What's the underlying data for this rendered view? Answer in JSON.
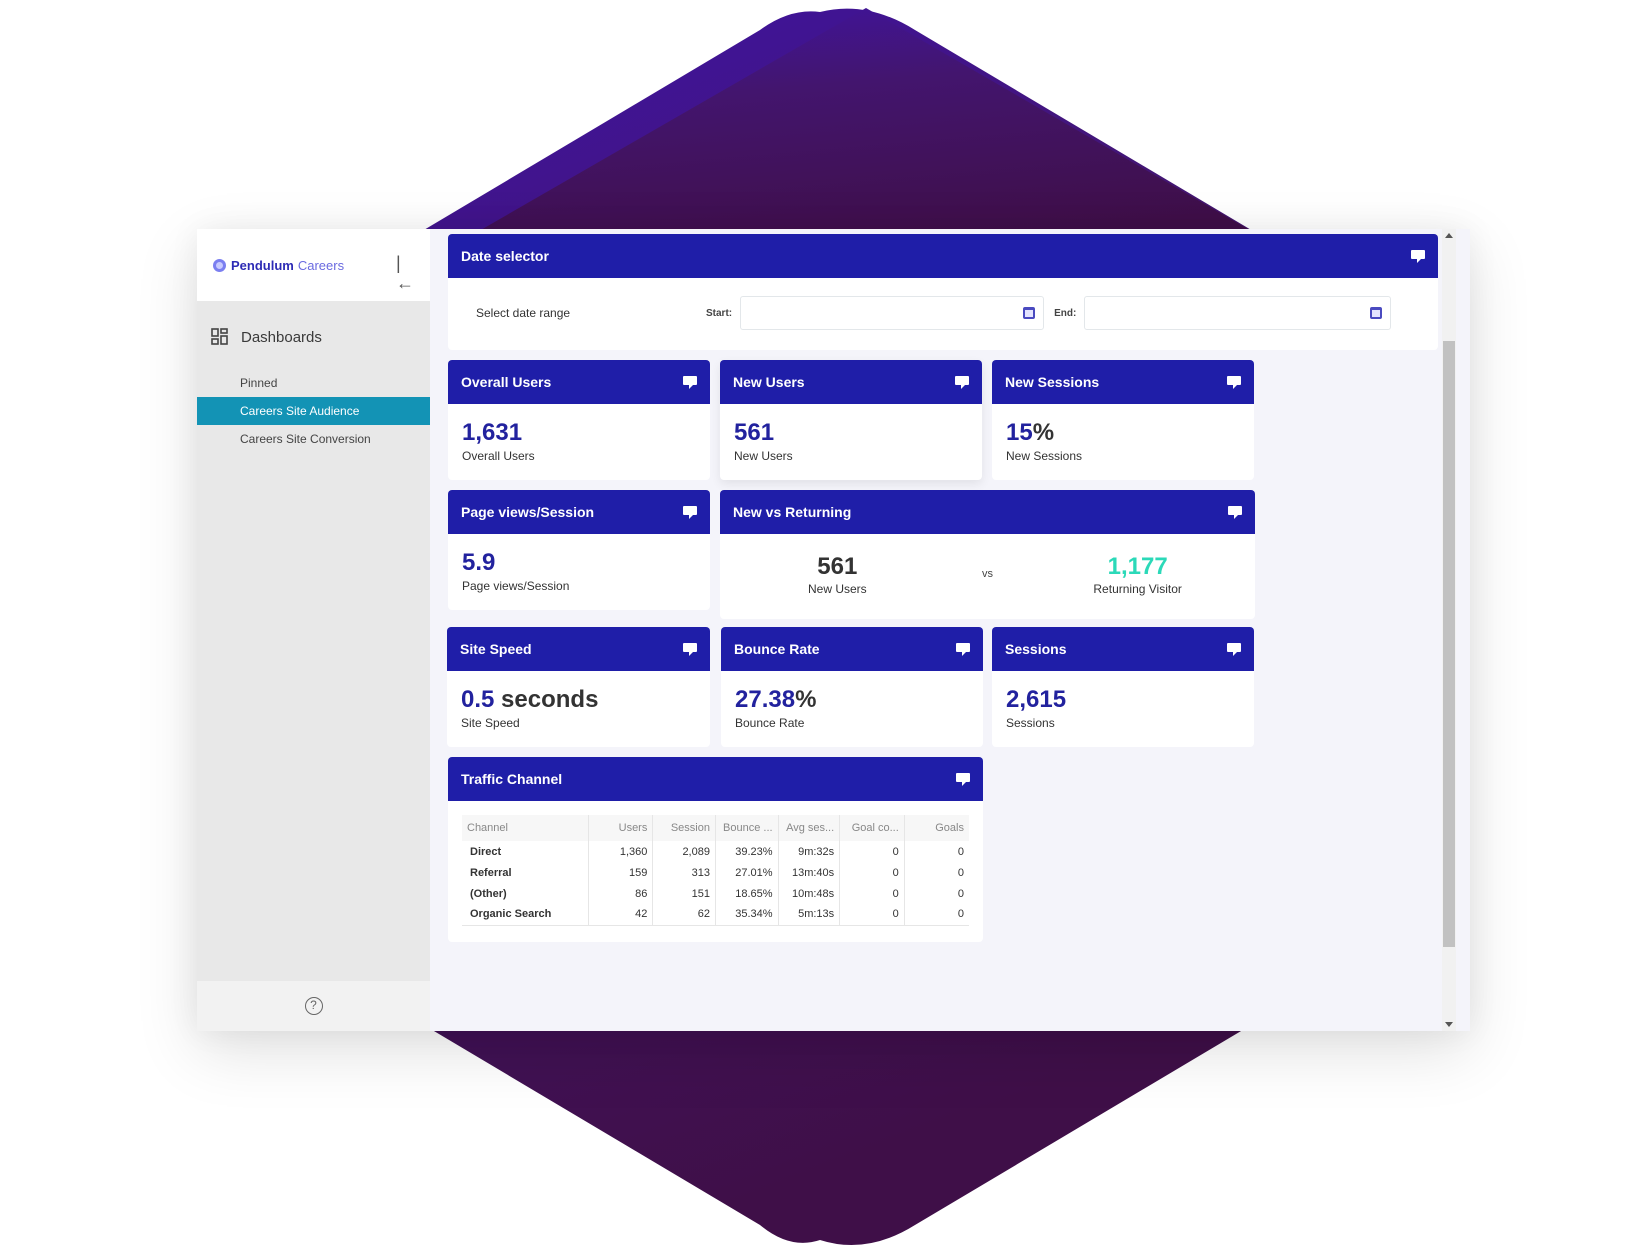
{
  "colors": {
    "accent": "#1f1ea8",
    "active_nav": "#1393b5",
    "returning": "#2bd9b8",
    "value": "#22229e"
  },
  "sidebar": {
    "brand_primary": "Pendulum",
    "brand_secondary": "Careers",
    "section_label": "Dashboards",
    "items": [
      {
        "label": "Pinned",
        "active": false
      },
      {
        "label": "Careers Site Audience",
        "active": true
      },
      {
        "label": "Careers Site Conversion",
        "active": false
      }
    ],
    "collapse_icon": "collapse-left-icon",
    "help_icon": "help-icon"
  },
  "date_selector": {
    "title": "Date selector",
    "prompt": "Select date range",
    "start_label": "Start:",
    "start_value": "",
    "end_label": "End:",
    "end_value": ""
  },
  "kpis": {
    "overall_users": {
      "title": "Overall Users",
      "value": "1,631",
      "label": "Overall Users"
    },
    "new_users": {
      "title": "New Users",
      "value": "561",
      "label": "New Users"
    },
    "new_sessions": {
      "title": "New Sessions",
      "value": "15",
      "unit": "%",
      "label": "New Sessions"
    },
    "page_views": {
      "title": "Page views/Session",
      "value": "5.9",
      "label": "Page views/Session"
    },
    "site_speed": {
      "title": "Site Speed",
      "value": "0.5",
      "unit": " seconds",
      "label": "Site Speed"
    },
    "bounce_rate": {
      "title": "Bounce Rate",
      "value": "27.38",
      "unit": "%",
      "label": "Bounce Rate"
    },
    "sessions": {
      "title": "Sessions",
      "value": "2,615",
      "label": "Sessions"
    }
  },
  "new_vs_returning": {
    "title": "New vs Returning",
    "new_value": "561",
    "new_label": "New Users",
    "vs": "vs",
    "returning_value": "1,177",
    "returning_label": "Returning Visitor"
  },
  "traffic": {
    "title": "Traffic Channel",
    "columns": [
      "Channel",
      "Users",
      "Session",
      "Bounce ...",
      "Avg ses...",
      "Goal co...",
      "Goals"
    ],
    "rows": [
      [
        "Direct",
        "1,360",
        "2,089",
        "39.23%",
        "9m:32s",
        "0",
        "0"
      ],
      [
        "Referral",
        "159",
        "313",
        "27.01%",
        "13m:40s",
        "0",
        "0"
      ],
      [
        "(Other)",
        "86",
        "151",
        "18.65%",
        "10m:48s",
        "0",
        "0"
      ],
      [
        "Organic Search",
        "42",
        "62",
        "35.34%",
        "5m:13s",
        "0",
        "0"
      ]
    ]
  }
}
